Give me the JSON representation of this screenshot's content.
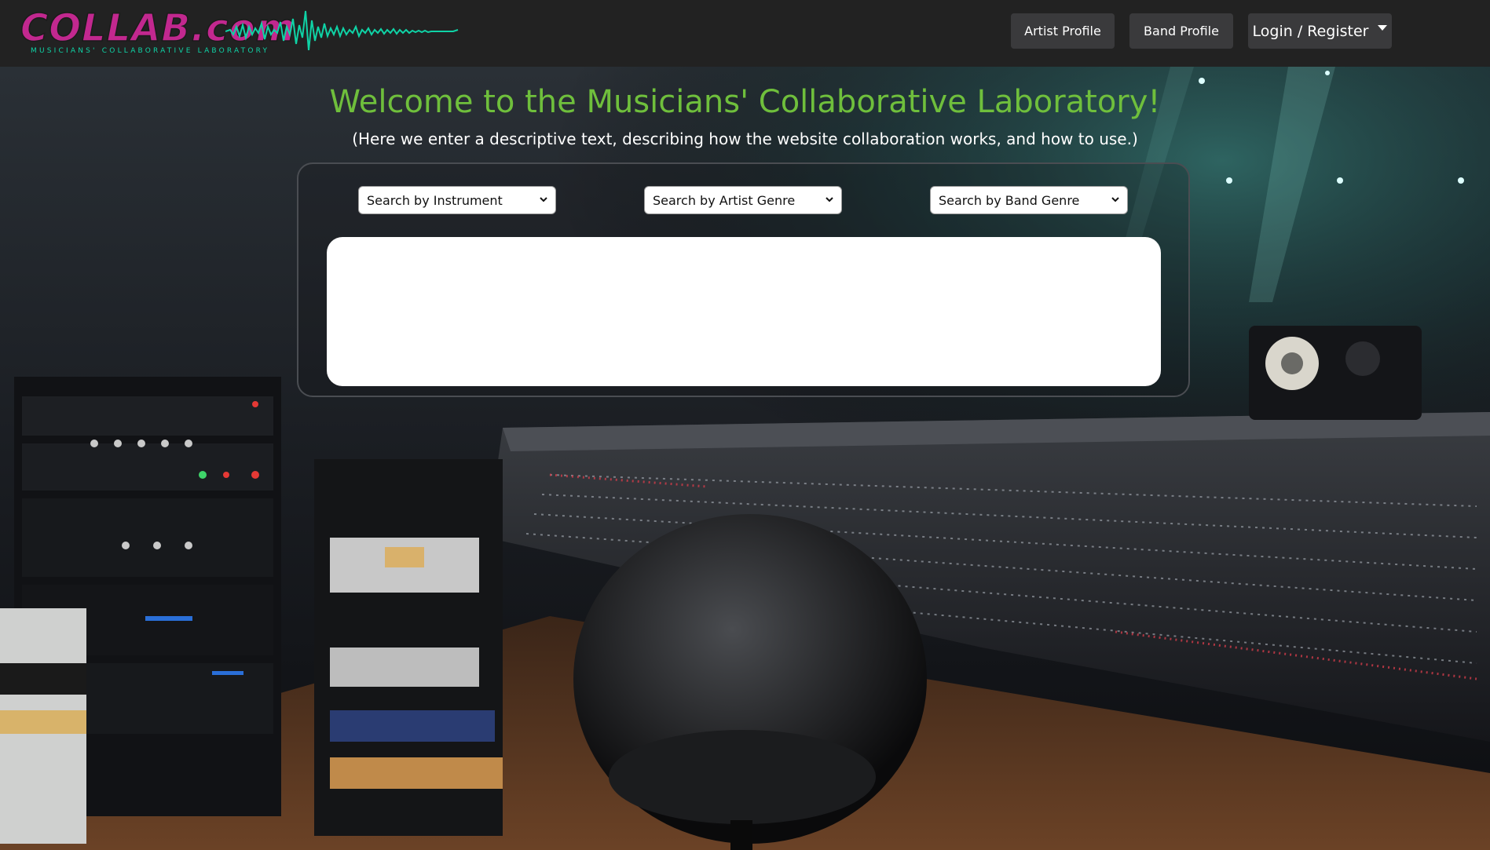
{
  "nav": {
    "logo_text": "COLLAB.com",
    "logo_tagline": "MUSICIANS' COLLABORATIVE LABORATORY",
    "artist_profile_label": "Artist Profile",
    "band_profile_label": "Band Profile",
    "login_label": "Login / Register"
  },
  "hero": {
    "title": "Welcome to the Musicians' Collaborative Laboratory!",
    "subtitle": "(Here we enter a descriptive text, describing how the website collaboration works, and how to use.)"
  },
  "search": {
    "instrument_selected": "Search by Instrument",
    "artist_genre_selected": "Search by Artist Genre",
    "band_genre_selected": "Search by Band Genre"
  },
  "colors": {
    "navbar_bg": "#222222",
    "logo_pink": "#c2288f",
    "logo_teal": "#0fd3a6",
    "title_green": "#6fbf3c",
    "button_bg": "#3a3a3c"
  },
  "icons": {
    "login_dropdown": "caret-down-icon",
    "select_chevron": "chevron-down-icon"
  }
}
